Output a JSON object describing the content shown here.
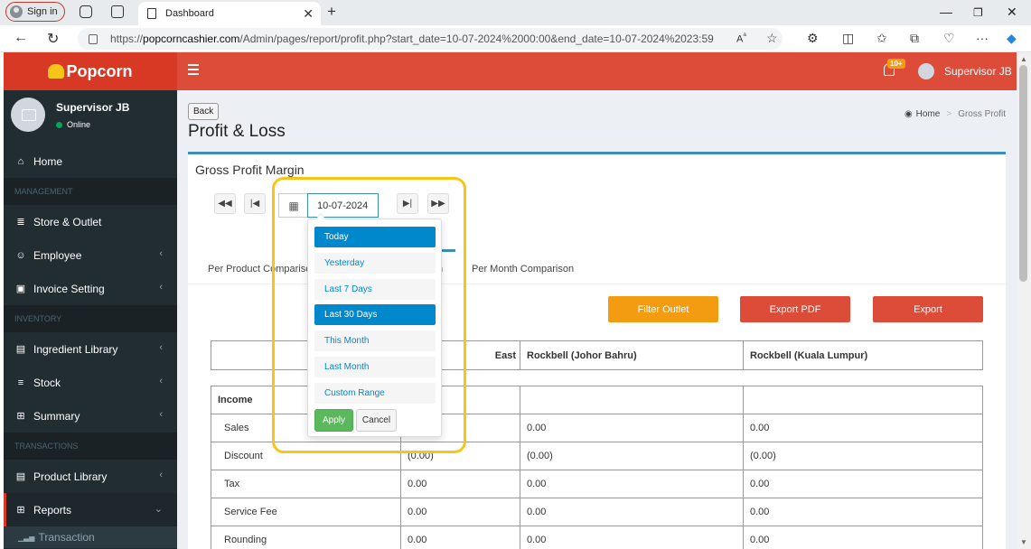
{
  "browser": {
    "signin": "Sign in",
    "tab_title": "Dashboard",
    "url_prefix": "https://",
    "url_host": "popcorncashier.com",
    "url_path": "/Admin/pages/report/profit.php?start_date=10-07-2024%2000:00&end_date=10-07-2024%2023:59"
  },
  "sidebar": {
    "brand": "Popcorn",
    "user_name": "Supervisor JB",
    "user_status": "Online",
    "items": [
      {
        "type": "item",
        "label": "Home",
        "icon": "home-icon",
        "glyph": "⌂",
        "chevron": ""
      },
      {
        "type": "header",
        "label": "MANAGEMENT"
      },
      {
        "type": "item",
        "label": "Store & Outlet",
        "icon": "bank-icon",
        "glyph": "≣",
        "chevron": ""
      },
      {
        "type": "item",
        "label": "Employee",
        "icon": "users-icon",
        "glyph": "☺",
        "chevron": "‹"
      },
      {
        "type": "item",
        "label": "Invoice Setting",
        "icon": "invoice-icon",
        "glyph": "▣",
        "chevron": "‹"
      },
      {
        "type": "header",
        "label": "INVENTORY"
      },
      {
        "type": "item",
        "label": "Ingredient Library",
        "icon": "book-icon",
        "glyph": "▤",
        "chevron": "‹"
      },
      {
        "type": "item",
        "label": "Stock",
        "icon": "database-icon",
        "glyph": "≡",
        "chevron": "‹"
      },
      {
        "type": "item",
        "label": "Summary",
        "icon": "table-icon",
        "glyph": "⊞",
        "chevron": "‹"
      },
      {
        "type": "header",
        "label": "TRANSACTIONS"
      },
      {
        "type": "item",
        "label": "Product Library",
        "icon": "book-icon",
        "glyph": "▤",
        "chevron": "‹"
      },
      {
        "type": "item",
        "label": "Reports",
        "icon": "table-icon",
        "glyph": "⊞",
        "chevron": "⌄",
        "active": true
      },
      {
        "type": "sub",
        "label": "Transaction",
        "icon": "bar-chart-icon",
        "glyph": "▁▃▅"
      }
    ]
  },
  "topbar": {
    "notif_badge": "10+",
    "user_name": "Supervisor JB"
  },
  "page": {
    "back": "Back",
    "title": "Profit & Loss",
    "crumb_home": "Home",
    "crumb_current": "Gross Profit",
    "box_title": "Gross Profit Margin",
    "date_value": "10-07-2024",
    "tabs": [
      "Per Product Comparison",
      "n",
      "Per Month Comparison"
    ],
    "buttons": {
      "filter": "Filter Outlet",
      "pdf": "Export PDF",
      "export": "Export"
    },
    "colors": {
      "filter": "#f39c12",
      "export": "#dd4b39",
      "accent": "#3c8dbc"
    }
  },
  "date_ranges": {
    "options": [
      "Today",
      "Yesterday",
      "Last 7 Days",
      "Last 30 Days",
      "This Month",
      "Last Month",
      "Custom Range"
    ],
    "active": [
      "Today",
      "Last 30 Days"
    ],
    "apply": "Apply",
    "cancel": "Cancel"
  },
  "table": {
    "headers": [
      "",
      "East",
      "Rockbell (Johor Bahru)",
      "Rockbell (Kuala Lumpur)"
    ],
    "rows": [
      {
        "label": "Income",
        "values": [
          "",
          "",
          ""
        ],
        "bold": true
      },
      {
        "label": "Sales",
        "values": [
          "",
          "0.00",
          "0.00"
        ]
      },
      {
        "label": "Discount",
        "values": [
          "(0.00)",
          "(0.00)",
          "(0.00)"
        ]
      },
      {
        "label": "Tax",
        "values": [
          "0.00",
          "0.00",
          "0.00"
        ]
      },
      {
        "label": "Service Fee",
        "values": [
          "0.00",
          "0.00",
          "0.00"
        ]
      },
      {
        "label": "Rounding",
        "values": [
          "0.00",
          "0.00",
          "0.00"
        ]
      }
    ]
  }
}
